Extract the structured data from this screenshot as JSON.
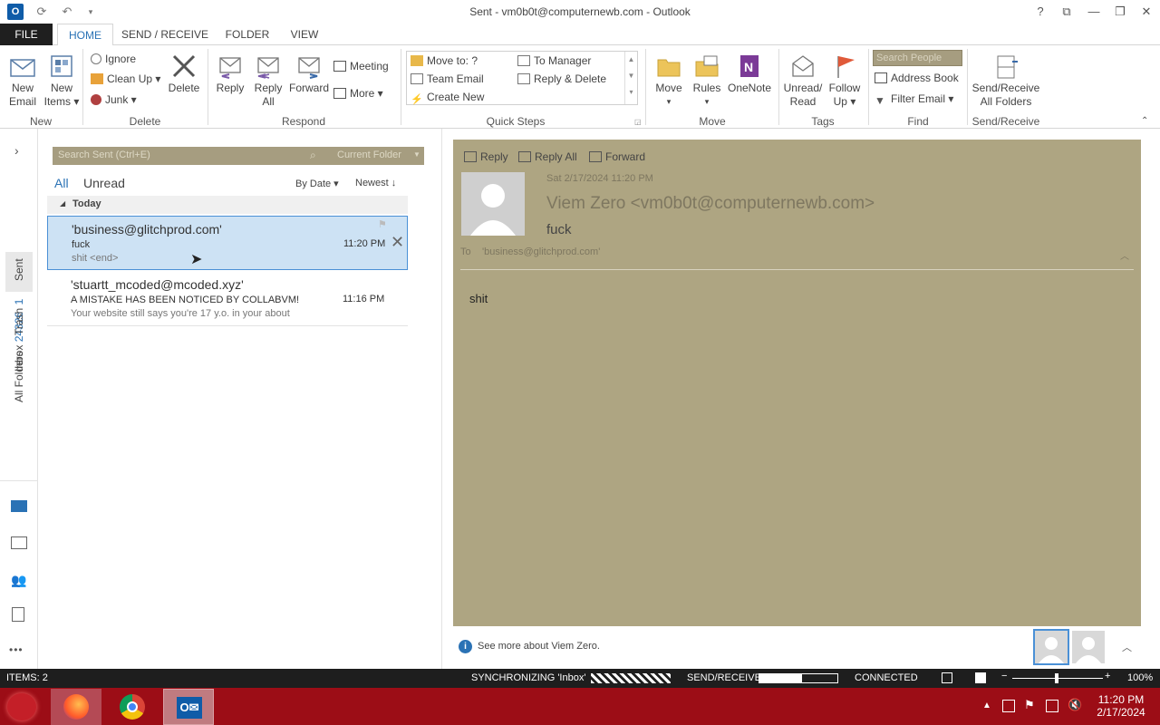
{
  "window": {
    "title": "Sent - vm0b0t@computernewb.com - Outlook",
    "app_icon_label": "O",
    "controls": [
      "?",
      "⧉",
      "—",
      "❐",
      "✕"
    ]
  },
  "tabs": {
    "file": "FILE",
    "items": [
      "HOME",
      "SEND / RECEIVE",
      "FOLDER",
      "VIEW"
    ]
  },
  "ribbon": {
    "new": {
      "new_email": [
        "New",
        "Email"
      ],
      "new_items": [
        "New",
        "Items ▾"
      ],
      "label": "New"
    },
    "delete": {
      "ignore": "Ignore",
      "clean_up": "Clean Up ▾",
      "junk": "Junk ▾",
      "delete": "Delete",
      "label": "Delete"
    },
    "respond": {
      "reply": "Reply",
      "reply_all": [
        "Reply",
        "All"
      ],
      "forward": "Forward",
      "meeting": "Meeting",
      "more": "More ▾",
      "label": "Respond"
    },
    "quick_steps": {
      "items": [
        "Move to: ?",
        "Team Email",
        "Create New",
        "To Manager",
        "Reply & Delete"
      ],
      "label": "Quick Steps"
    },
    "move": {
      "move": "Move",
      "rules": "Rules",
      "onenote": "OneNote",
      "label": "Move"
    },
    "tags": {
      "unread": [
        "Unread/",
        "Read"
      ],
      "follow_up": [
        "Follow",
        "Up ▾"
      ],
      "label": "Tags"
    },
    "find": {
      "search_people": "Search People",
      "address_book": "Address Book",
      "filter_email": "Filter Email ▾",
      "label": "Find"
    },
    "send_receive": {
      "button": [
        "Send/Receive",
        "All Folders"
      ],
      "label": "Send/Receive"
    }
  },
  "leftnav": {
    "expand": "›",
    "folders": [
      {
        "label": "Inbox",
        "count": "24326"
      },
      {
        "label": "Sent",
        "count": ""
      },
      {
        "label": "Trash",
        "count": "1"
      },
      {
        "label": "All Folders",
        "count": ""
      }
    ],
    "more": "•••"
  },
  "list": {
    "search_placeholder": "Search Sent (Ctrl+E)",
    "scope": "Current Folder",
    "filter_all": "All",
    "filter_unread": "Unread",
    "sort_by": "By Date ▾",
    "order": "Newest ↓",
    "group": "Today",
    "messages": [
      {
        "from": "'business@glitchprod.com'",
        "subject": "fuck",
        "preview": "shit <end>",
        "time": "11:20 PM"
      },
      {
        "from": "'stuartt_mcoded@mcoded.xyz'",
        "subject": "A MISTAKE HAS BEEN NOTICED BY COLLABVM!",
        "preview": "Your website still says you're 17 y.o. in your about",
        "time": "11:16 PM"
      }
    ]
  },
  "reading": {
    "actions": [
      "Reply",
      "Reply All",
      "Forward"
    ],
    "date": "Sat 2/17/2024 11:20 PM",
    "sender": "Viem Zero <vm0b0t@computernewb.com>",
    "subject": "fuck",
    "to_label": "To",
    "to_value": "'business@glitchprod.com'",
    "body": "shit",
    "people_info": "See more about Viem Zero."
  },
  "status": {
    "items": "ITEMS: 2",
    "sync": "SYNCHRONIZING  'Inbox'",
    "send_receive": "SEND/RECEIVE",
    "connected": "CONNECTED",
    "zoom": "100%"
  },
  "taskbar": {
    "time": "11:20 PM",
    "date": "2/17/2024"
  },
  "colors": {
    "accent": "#2a72b5",
    "reading_bg": "#aea582",
    "taskbar": "#9c0d16"
  }
}
